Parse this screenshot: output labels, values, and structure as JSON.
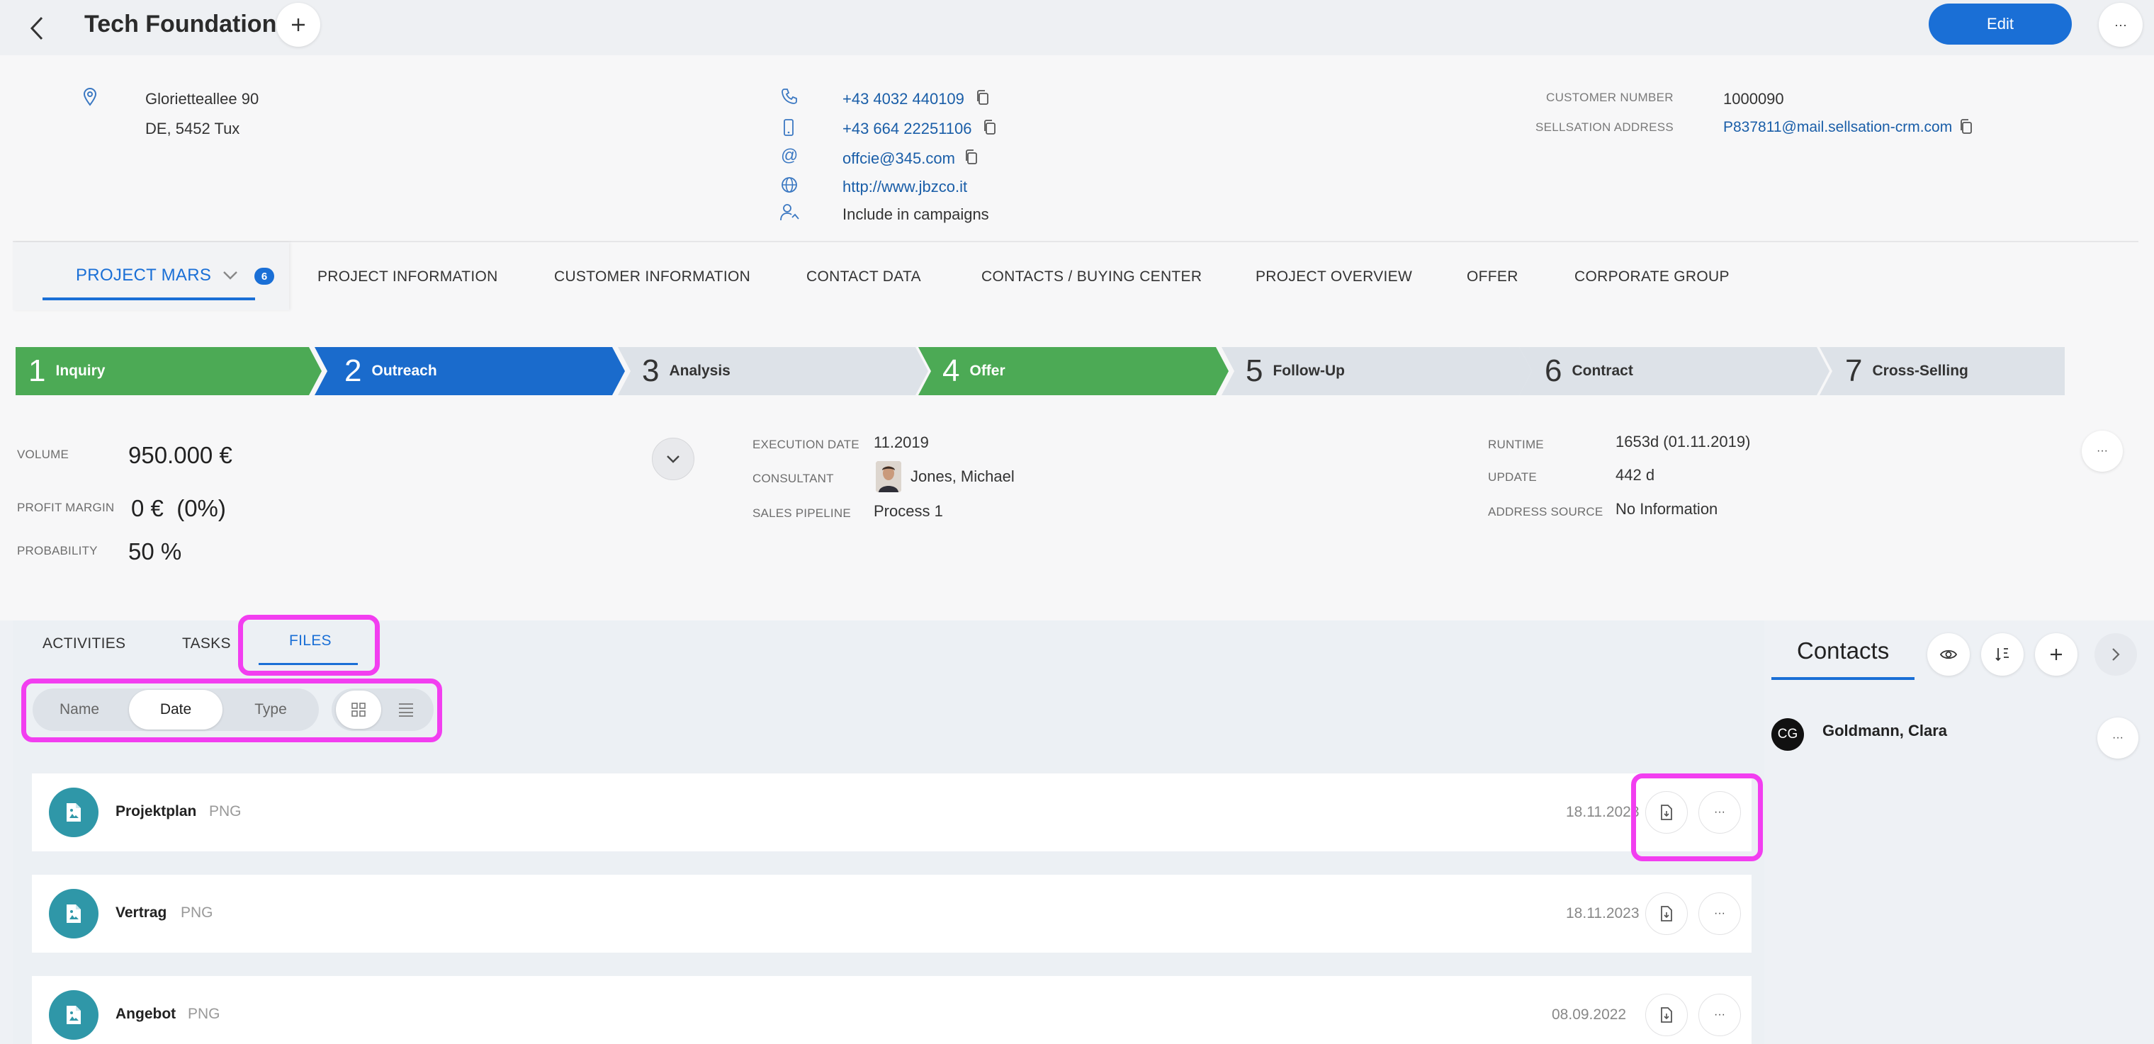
{
  "header": {
    "title": "Tech Foundation",
    "edit_label": "Edit",
    "more_label": "···"
  },
  "address": {
    "street": "Glorietteallee 90",
    "city": "DE, 5452 Tux"
  },
  "contact_info": {
    "phone": "+43 4032 440109",
    "mobile": "+43 664 22251106",
    "email": "offcie@345.com",
    "website": "http://www.jbzco.it",
    "campaigns": "Include in campaigns"
  },
  "customer": {
    "number_label": "CUSTOMER NUMBER",
    "number": "1000090",
    "sellsation_label": "SELLSATION ADDRESS",
    "sellsation": "P837811@mail.sellsation-crm.com"
  },
  "project_tab": {
    "label": "PROJECT MARS",
    "badge": "6"
  },
  "nav_tabs": [
    {
      "label": "PROJECT INFORMATION"
    },
    {
      "label": "CUSTOMER INFORMATION"
    },
    {
      "label": "CONTACT DATA"
    },
    {
      "label": "CONTACTS / BUYING CENTER"
    },
    {
      "label": "PROJECT OVERVIEW"
    },
    {
      "label": "OFFER"
    },
    {
      "label": "CORPORATE GROUP"
    }
  ],
  "pipeline": [
    {
      "num": "1",
      "label": "Inquiry",
      "state": "done",
      "color": "#4caa55"
    },
    {
      "num": "2",
      "label": "Outreach",
      "state": "active",
      "color": "#1a6bcc"
    },
    {
      "num": "3",
      "label": "Analysis",
      "state": "todo",
      "color": "#dde2e8"
    },
    {
      "num": "4",
      "label": "Offer",
      "state": "done",
      "color": "#4caa55"
    },
    {
      "num": "5",
      "label": "Follow-Up",
      "state": "todo",
      "color": "#dde2e8"
    },
    {
      "num": "6",
      "label": "Contract",
      "state": "todo",
      "color": "#dde2e8"
    },
    {
      "num": "7",
      "label": "Cross-Selling",
      "state": "todo",
      "color": "#dde2e8"
    }
  ],
  "stats": {
    "volume_label": "VOLUME",
    "volume": "950.000 €",
    "profit_label": "PROFIT MARGIN",
    "profit": "0 €  (0%)",
    "probability_label": "PROBABILITY",
    "probability": "50 %"
  },
  "meta": {
    "execution_label": "EXECUTION DATE",
    "execution": "11.2019",
    "consultant_label": "CONSULTANT",
    "consultant": "Jones, Michael",
    "pipeline_label": "SALES PIPELINE",
    "pipeline": "Process 1",
    "runtime_label": "RUNTIME",
    "runtime": "1653d (01.11.2019)",
    "update_label": "UPDATE",
    "update": "442 d",
    "source_label": "ADDRESS SOURCE",
    "source": "No Information"
  },
  "lower_tabs": {
    "activities": "ACTIVITIES",
    "tasks": "TASKS",
    "files": "FILES"
  },
  "sort": {
    "name": "Name",
    "date": "Date",
    "type": "Type"
  },
  "files": [
    {
      "name": "Projektplan",
      "ext": "PNG",
      "date": "18.11.2023"
    },
    {
      "name": "Vertrag",
      "ext": "PNG",
      "date": "18.11.2023"
    },
    {
      "name": "Angebot",
      "ext": "PNG",
      "date": "08.09.2022"
    }
  ],
  "contacts_panel": {
    "title": "Contacts",
    "contact_initials": "CG",
    "contact_name": "Goldmann, Clara"
  },
  "colors": {
    "accent": "#1a6fd6",
    "green": "#4caa55",
    "file_icon": "#2f97a8",
    "highlight": "#f23ef0"
  }
}
